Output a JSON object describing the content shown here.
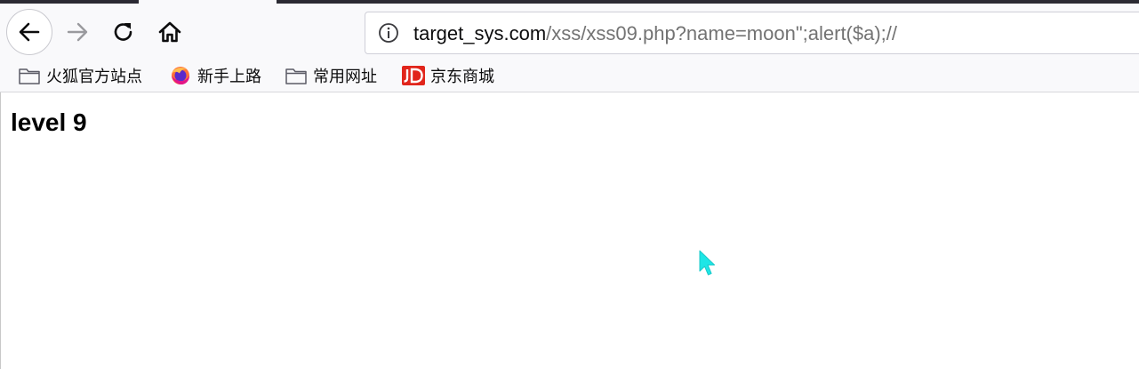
{
  "toolbar": {
    "back_icon": "back-arrow-icon",
    "forward_icon": "forward-arrow-icon",
    "reload_icon": "reload-icon",
    "home_icon": "home-icon"
  },
  "urlbar": {
    "host": "target_sys.com",
    "path": "/xss/xss09.php?name=moon\";alert($a);//",
    "info_icon": "info-icon"
  },
  "bookmarks": [
    {
      "label": "火狐官方站点",
      "icon": "folder-icon"
    },
    {
      "label": "新手上路",
      "icon": "firefox-icon"
    },
    {
      "label": "常用网址",
      "icon": "folder-icon"
    },
    {
      "label": "京东商城",
      "icon": "jd-icon"
    }
  ],
  "page": {
    "heading": "level 9"
  },
  "colors": {
    "toolbar_bg": "#f9f9fb",
    "cursor": "#1ee6e6",
    "jd_red": "#e1251b"
  }
}
